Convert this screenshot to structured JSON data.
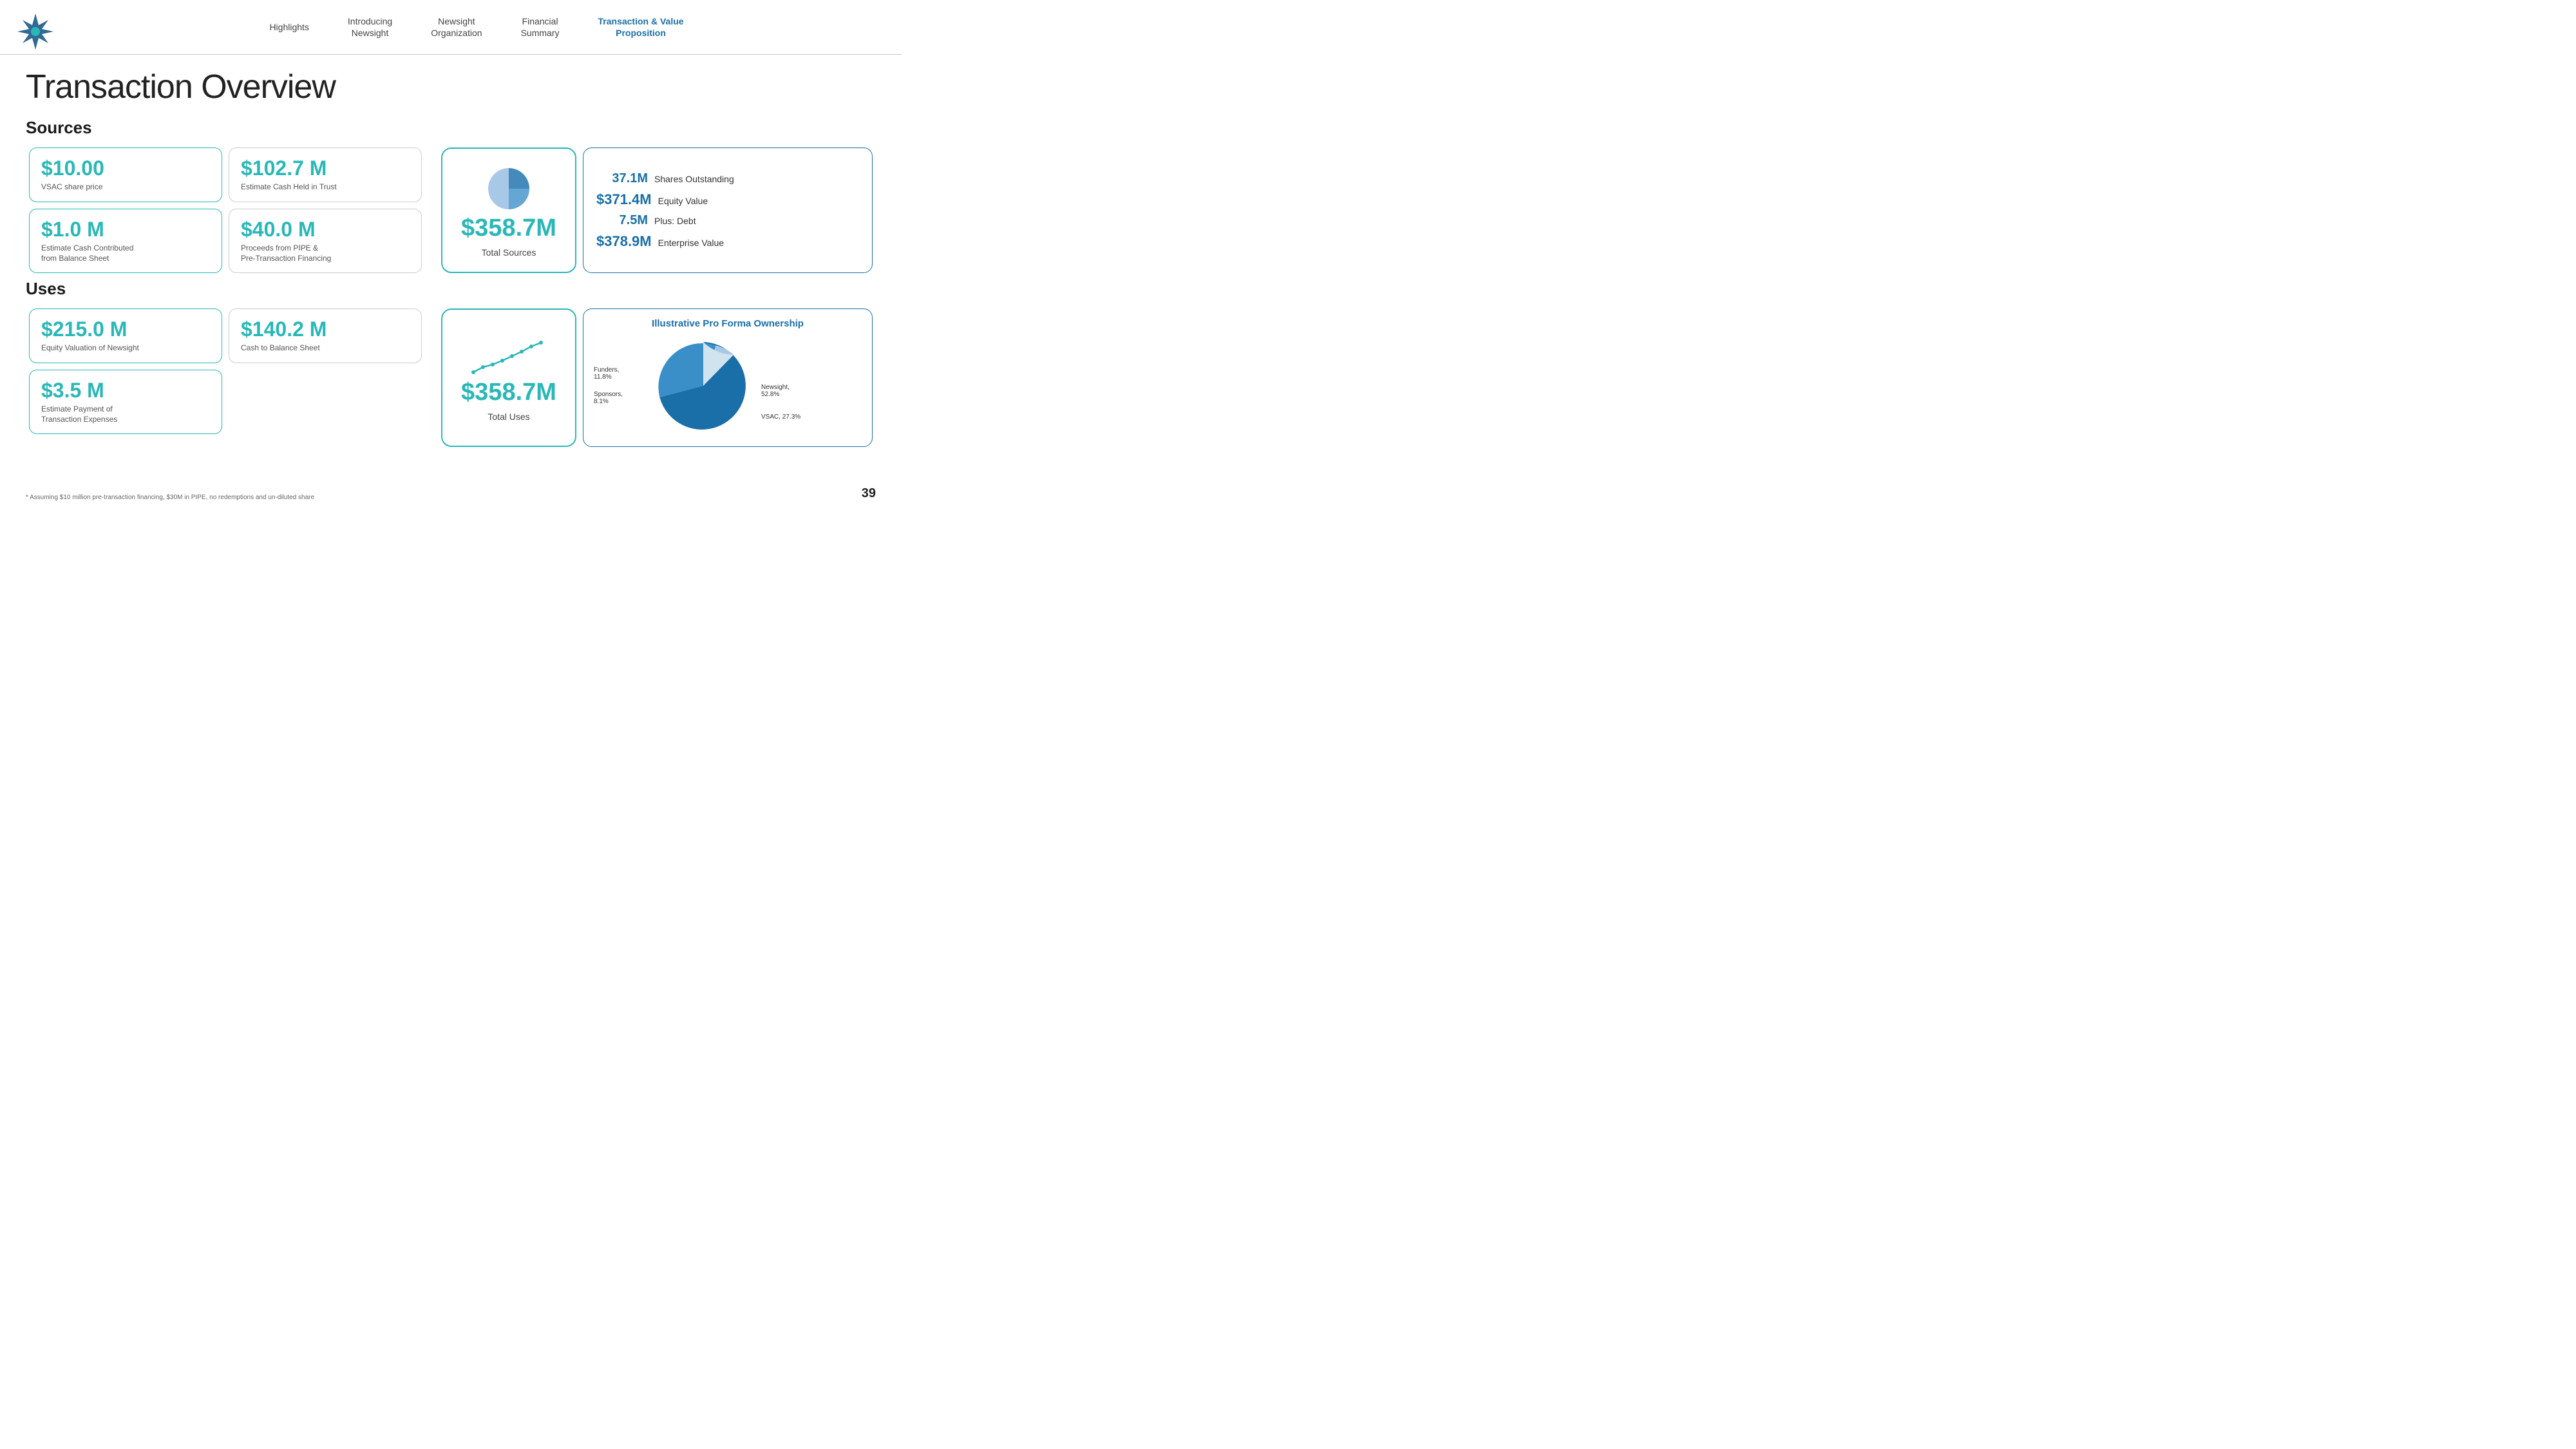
{
  "nav": {
    "links": [
      {
        "label": "Highlights",
        "active": false
      },
      {
        "label": "Introducing\nNewsight",
        "active": false
      },
      {
        "label": "Newsight\nOrganization",
        "active": false
      },
      {
        "label": "Financial\nSummary",
        "active": false
      },
      {
        "label": "Transaction & Value\nProposition",
        "active": true
      }
    ]
  },
  "page": {
    "title": "Transaction Overview"
  },
  "sources": {
    "label": "Sources",
    "cards": [
      {
        "value": "$10.00",
        "label": "VSAC share price"
      },
      {
        "value": "$102.7 M",
        "label": "Estimate Cash Held in Trust"
      },
      {
        "value": "$1.0 M",
        "label": "Estimate Cash Contributed\nfrom Balance Sheet"
      },
      {
        "value": "$40.0 M",
        "label": "Proceeds from PIPE &\nPre-Transaction Financing"
      }
    ],
    "total": {
      "value": "$358.7M",
      "label": "Total Sources"
    }
  },
  "summary": {
    "rows": [
      {
        "num": "37.1M",
        "desc": "Shares Outstanding",
        "large": false
      },
      {
        "num": "$371.4M",
        "desc": "Equity Value",
        "large": true
      },
      {
        "num": "7.5M",
        "desc": "Plus: Debt",
        "large": false
      },
      {
        "num": "$378.9M",
        "desc": "Enterprise Value",
        "large": true
      }
    ]
  },
  "uses": {
    "label": "Uses",
    "cards": [
      {
        "value": "$215.0 M",
        "label": "Equity Valuation of Newsight"
      },
      {
        "value": "$140.2 M",
        "label": "Cash to Balance Sheet"
      },
      {
        "value": "$3.5 M",
        "label": "Estimate Payment of\nTransaction Expenses"
      }
    ],
    "total": {
      "value": "$358.7M",
      "label": "Total Uses"
    }
  },
  "ownership": {
    "title": "Illustrative Pro Forma Ownership",
    "segments": [
      {
        "label": "Newsight, 52.8%",
        "color": "#1a6fa8",
        "pct": 52.8
      },
      {
        "label": "VSAC, 27.3%",
        "color": "#3a8fc8",
        "pct": 27.3
      },
      {
        "label": "Sponsors, 8.1%",
        "color": "#a8c8e8",
        "pct": 8.1
      },
      {
        "label": "Funders, 11.8%",
        "color": "#c8ddf0",
        "pct": 11.8
      }
    ]
  },
  "footer": {
    "note": "* Assuming $10 million pre-transaction financing,  $30M in PIPE, no redemptions and un-diluted share",
    "page_num": "39"
  }
}
